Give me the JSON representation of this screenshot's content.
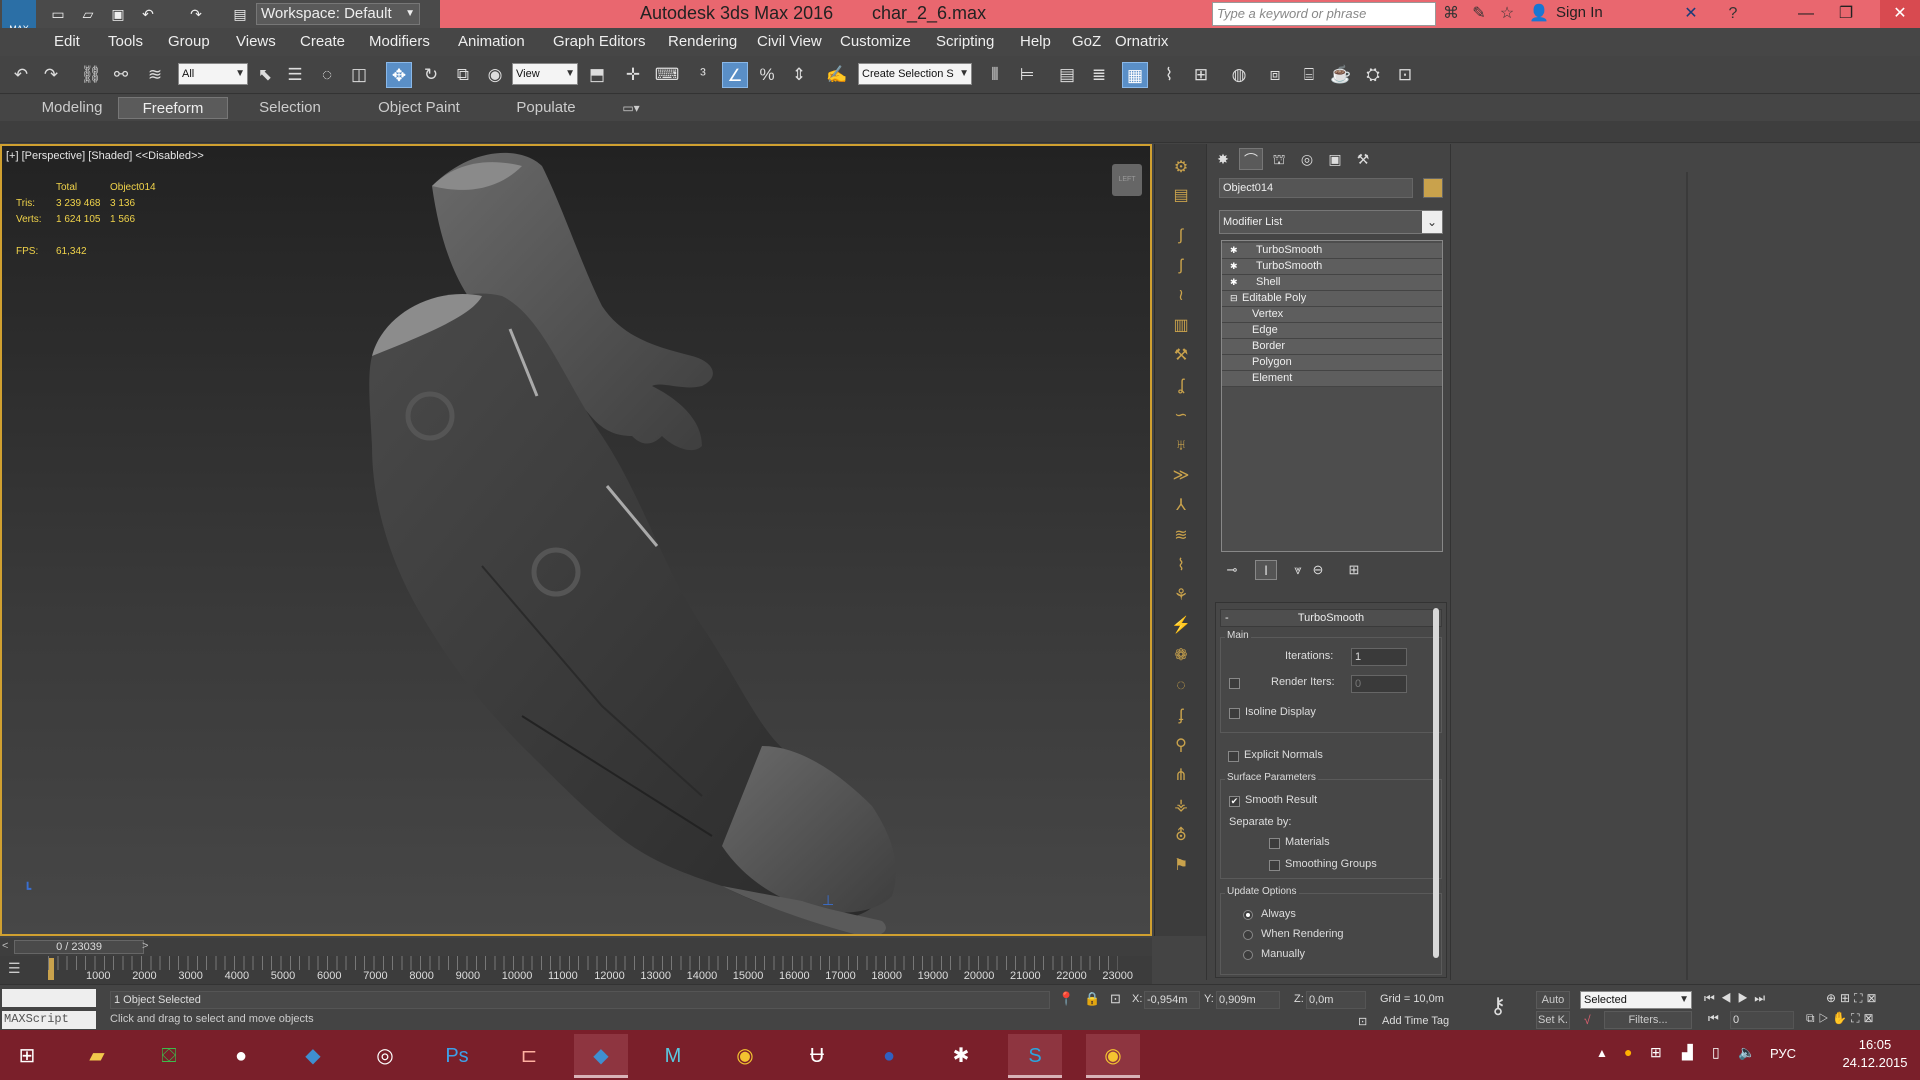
{
  "titlebar": {
    "workspace": "Workspace: Default",
    "app_title": "Autodesk 3ds Max 2016",
    "file_title": "char_2_6.max",
    "search_placeholder": "Type a keyword or phrase",
    "sign_in": "Sign In",
    "logo_text": "MAX"
  },
  "menus": [
    "Edit",
    "Tools",
    "Group",
    "Views",
    "Create",
    "Modifiers",
    "Animation",
    "Graph Editors",
    "Rendering",
    "Civil View",
    "Customize",
    "Scripting",
    "Help",
    "GoZ",
    "Ornatrix"
  ],
  "toolbar": {
    "selection_filter": "All",
    "ref_coord": "View",
    "named_selection": "Create Selection S"
  },
  "ribbon_tabs": [
    {
      "label": "Modeling",
      "active": false
    },
    {
      "label": "Freeform",
      "active": true
    },
    {
      "label": "Selection",
      "active": false
    },
    {
      "label": "Object Paint",
      "active": false
    },
    {
      "label": "Populate",
      "active": false
    }
  ],
  "viewport": {
    "label": "[+] [Perspective] [Shaded]  <<Disabled>>",
    "stats": {
      "col_total": "Total",
      "col_object": "Object014",
      "tris_label": "Tris:",
      "tris_total": "3 239 468",
      "tris_object": "3 136",
      "verts_label": "Verts:",
      "verts_total": "1 624 105",
      "verts_object": "1 566",
      "fps_label": "FPS:",
      "fps_value": "61,342"
    },
    "viewcube_text": "LEFT"
  },
  "command_panel": {
    "object_name": "Object014",
    "object_color": "#c9a24c",
    "modifier_list": "Modifier List",
    "stack": [
      {
        "label": "TurboSmooth",
        "type": "modifier"
      },
      {
        "label": "TurboSmooth",
        "type": "modifier"
      },
      {
        "label": "Shell",
        "type": "modifier"
      },
      {
        "label": "Editable Poly",
        "type": "base"
      },
      {
        "label": "Vertex",
        "type": "sub"
      },
      {
        "label": "Edge",
        "type": "sub"
      },
      {
        "label": "Border",
        "type": "sub"
      },
      {
        "label": "Polygon",
        "type": "sub"
      },
      {
        "label": "Element",
        "type": "sub"
      }
    ],
    "rollout": {
      "title": "TurboSmooth",
      "collapse_sign": "-",
      "main_group": "Main",
      "iterations_label": "Iterations:",
      "iterations_value": "1",
      "render_iters_label": "Render Iters:",
      "render_iters_value": "0",
      "isoline_display": "Isoline Display",
      "explicit_normals": "Explicit Normals",
      "surface_group": "Surface Parameters",
      "smooth_result": "Smooth Result",
      "separate_by": "Separate by:",
      "materials": "Materials",
      "smoothing_groups": "Smoothing Groups",
      "update_group": "Update Options",
      "always": "Always",
      "when_rendering": "When Rendering",
      "manually": "Manually"
    }
  },
  "timeline": {
    "slider": "0 / 23039",
    "ticks": [
      "1000",
      "2000",
      "3000",
      "4000",
      "5000",
      "6000",
      "7000",
      "8000",
      "9000",
      "10000",
      "11000",
      "12000",
      "13000",
      "14000",
      "15000",
      "16000",
      "17000",
      "18000",
      "19000",
      "20000",
      "21000",
      "22000",
      "23000"
    ]
  },
  "status": {
    "maxscript": "MAXScript",
    "selected": "1 Object Selected",
    "prompt": "Click and drag to select and move objects",
    "x_label": "X:",
    "x_value": "-0,954m",
    "y_label": "Y:",
    "y_value": "0,909m",
    "z_label": "Z:",
    "z_value": "0,0m",
    "grid": "Grid = 10,0m",
    "add_time_tag": "Add Time Tag",
    "auto": "Auto",
    "set_key": "Set K.",
    "selected_combo": "Selected",
    "filters": "Filters...",
    "frame": "0"
  },
  "taskbar": {
    "language": "РУС",
    "time": "16:05",
    "date": "24.12.2015"
  }
}
